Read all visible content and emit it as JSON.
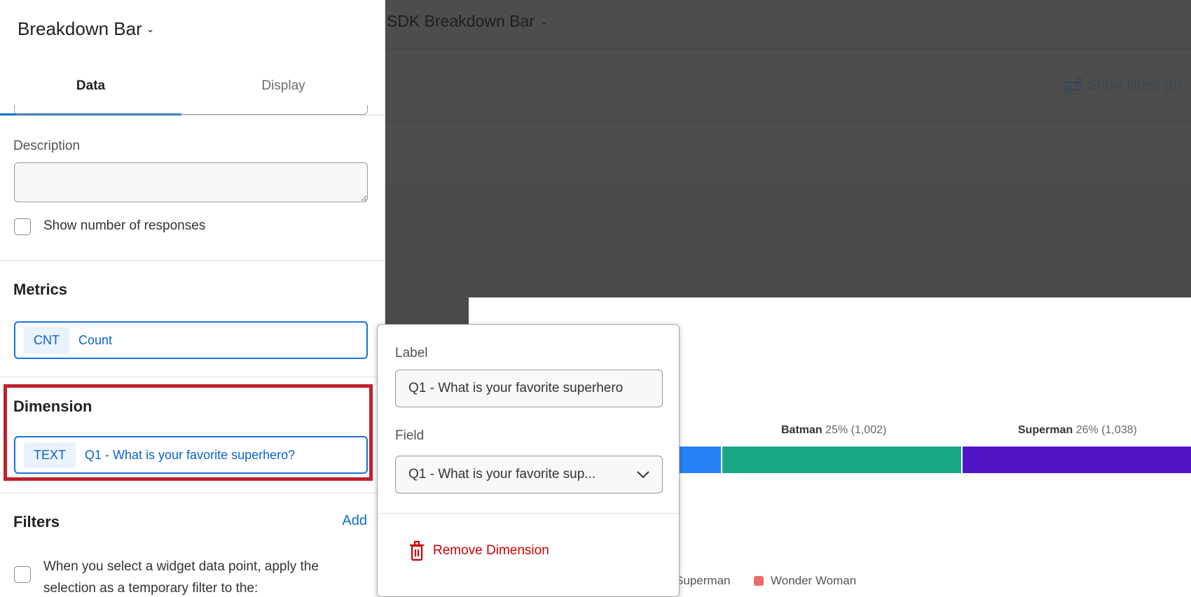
{
  "panel": {
    "title": "Breakdown Bar",
    "tabs": [
      {
        "label": "Data"
      },
      {
        "label": "Display"
      }
    ],
    "description_label": "Description",
    "description_value": "",
    "show_responses_label": "Show number of responses",
    "metrics": {
      "heading": "Metrics",
      "tag": "CNT",
      "label": "Count"
    },
    "dimension": {
      "heading": "Dimension",
      "tag": "TEXT",
      "label": "Q1 - What is your favorite superhero?"
    },
    "filters": {
      "heading": "Filters",
      "add_label": "Add",
      "option_text_1": "When you select a widget data point, apply the",
      "option_text_2": "selection as a temporary filter to the:"
    }
  },
  "dashboard": {
    "title": "SDK Breakdown Bar",
    "show_filters": "Show filters (0)"
  },
  "popover": {
    "label_heading": "Label",
    "label_value": "Q1 - What is your favorite superhero",
    "field_heading": "Field",
    "field_value": "Q1 - What is your favorite sup...",
    "remove_label": "Remove Dimension"
  },
  "chart_data": {
    "type": "bar",
    "segments": [
      {
        "name": "",
        "color": "#2680f6"
      },
      {
        "name": "Batman",
        "percent": "25%",
        "count": "(1,002)",
        "value": 1002,
        "color": "#1aa884"
      },
      {
        "name": "Superman",
        "percent": "26%",
        "count": "(1,038)",
        "value": 1038,
        "color": "#5115c6"
      }
    ],
    "legend": [
      {
        "name": "Superman",
        "color": "#5115c6"
      },
      {
        "name": "Wonder Woman",
        "color": "#ee6b6b"
      }
    ]
  }
}
